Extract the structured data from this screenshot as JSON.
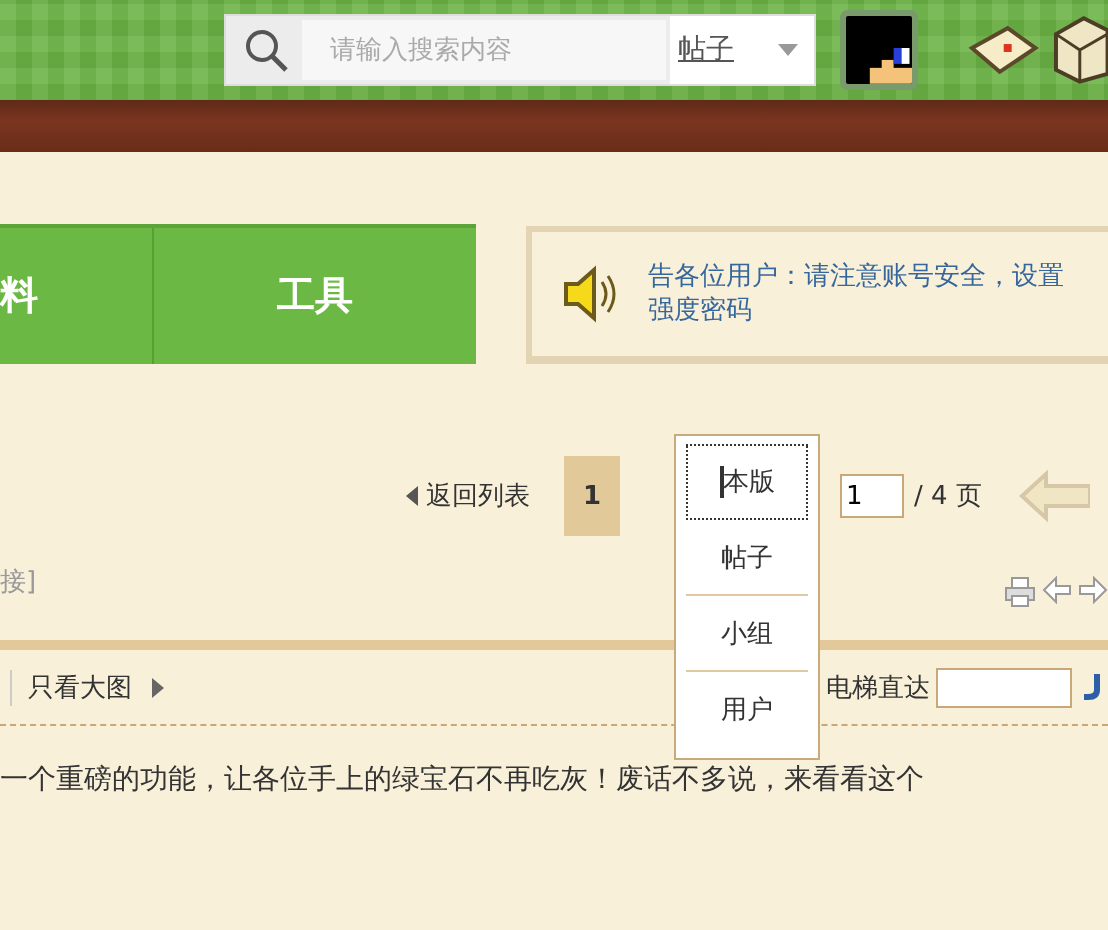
{
  "header": {
    "search": {
      "placeholder": "请输入搜索内容",
      "scope": "帖子"
    }
  },
  "nav": {
    "items": [
      {
        "label": "料"
      },
      {
        "label": "工具"
      }
    ]
  },
  "notice": {
    "lines": [
      "告各位用户：请注意账号安全，设置",
      "强度密码"
    ]
  },
  "pagination": {
    "back": "返回列表",
    "pages": [
      {
        "label": "1",
        "selected": true
      }
    ],
    "page_input": "1",
    "total": "/ 4 页"
  },
  "search_scope_menu": {
    "items": [
      {
        "label": "本版",
        "selected": true
      },
      {
        "label": "帖子",
        "selected": false
      },
      {
        "label": "小组",
        "selected": false
      },
      {
        "label": "用户",
        "selected": false
      }
    ]
  },
  "link_text": "接]",
  "post_toolbar": {
    "view_large": "只看大图",
    "jump_label": "电梯直达"
  },
  "post_text": "一个重磅的功能，让各位手上的绿宝石不再吃灰！废话不多说，来看看这个"
}
